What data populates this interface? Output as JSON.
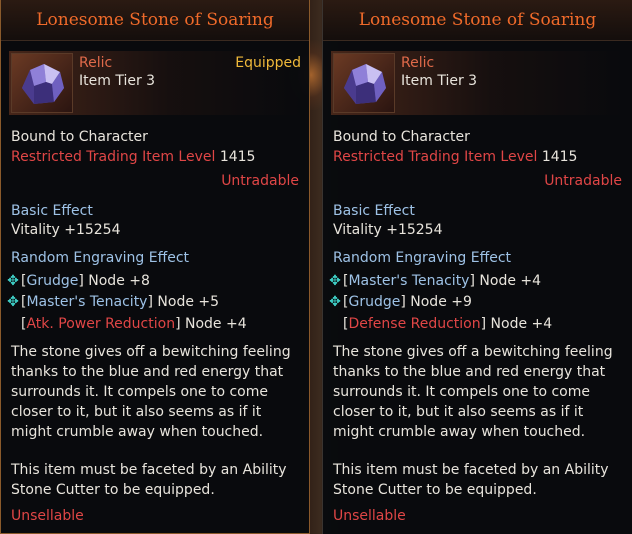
{
  "tooltips": [
    {
      "title": "Lonesome Stone of Soaring",
      "grade": "Relic",
      "tier": "Item Tier 3",
      "equipped": "Equipped",
      "bound": "Bound to Character",
      "restricted_label": "Restricted Trading Item Level",
      "restricted_value": "1415",
      "untradable": "Untradable",
      "basic_effect_label": "Basic Effect",
      "basic_effect_value": "Vitality +15254",
      "engraving_label": "Random Engraving Effect",
      "engravings": [
        {
          "name": "Grudge",
          "node": "Node +8",
          "type": "positive",
          "marker": "cross-diamond-icon"
        },
        {
          "name": "Master's Tenacity",
          "node": "Node +5",
          "type": "positive",
          "marker": "cross-diamond-icon"
        },
        {
          "name": "Atk. Power Reduction",
          "node": "Node +4",
          "type": "negative",
          "marker": ""
        }
      ],
      "description": "The stone gives off a bewitching feeling thanks to the blue and red energy that surrounds it. It compels one to come closer to it, but it also seems as if it might crumble away when touched.",
      "facet_note": "This item must be faceted by an Ability Stone Cutter to be equipped.",
      "unsellable": "Unsellable"
    },
    {
      "title": "Lonesome Stone of Soaring",
      "grade": "Relic",
      "tier": "Item Tier 3",
      "equipped": "",
      "bound": "Bound to Character",
      "restricted_label": "Restricted Trading Item Level",
      "restricted_value": "1415",
      "untradable": "Untradable",
      "basic_effect_label": "Basic Effect",
      "basic_effect_value": "Vitality +15254",
      "engraving_label": "Random Engraving Effect",
      "engravings": [
        {
          "name": "Master's Tenacity",
          "node": "Node +4",
          "type": "positive",
          "marker": "cross-diamond-icon"
        },
        {
          "name": "Grudge",
          "node": "Node +9",
          "type": "positive",
          "marker": "cross-diamond-icon"
        },
        {
          "name": "Defense Reduction",
          "node": "Node +4",
          "type": "negative",
          "marker": ""
        }
      ],
      "description": "The stone gives off a bewitching feeling thanks to the blue and red energy that surrounds it. It compels one to come closer to it, but it also seems as if it might crumble away when touched.",
      "facet_note": "This item must be faceted by an Ability Stone Cutter to be equipped.",
      "unsellable": "Unsellable"
    }
  ],
  "colors": {
    "title": "#ef6a2a",
    "relic": "#e06a4a",
    "equipped": "#f0b93a",
    "negative": "#e04646",
    "label_blue": "#9ec2e6",
    "marker_teal": "#3fd2c9"
  },
  "icons": {
    "item": "ability-stone-crystal-icon"
  }
}
